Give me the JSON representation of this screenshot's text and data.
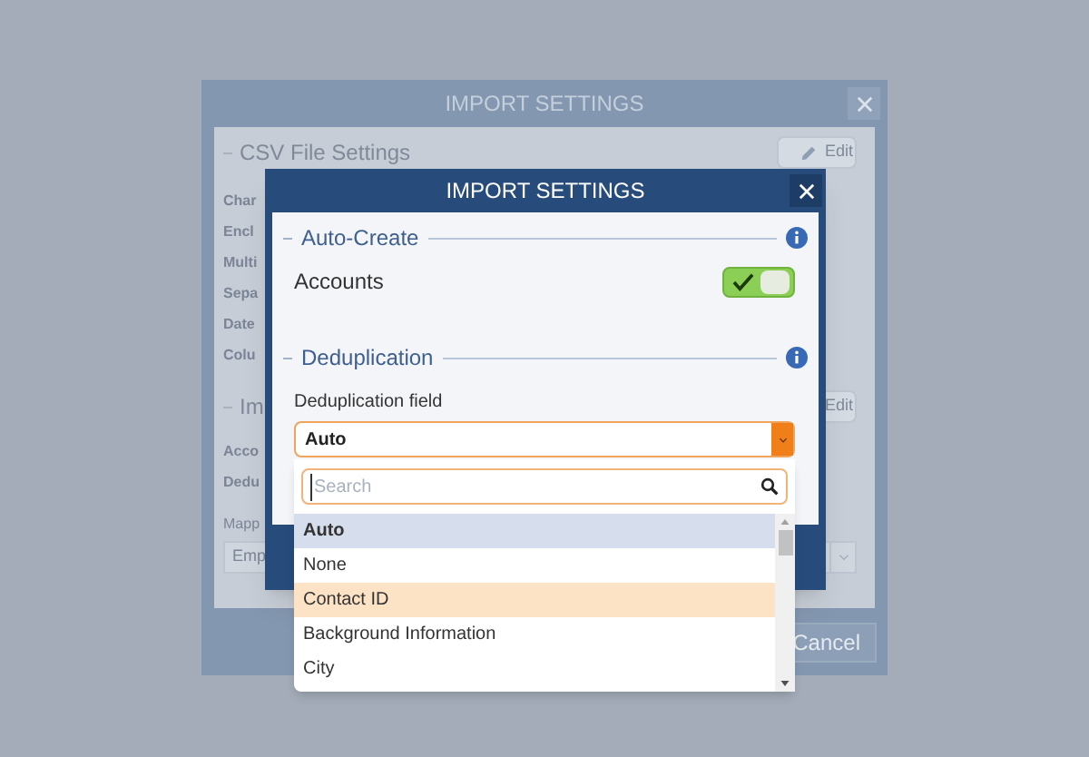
{
  "back_dialog": {
    "title": "IMPORT SETTINGS",
    "sections": [
      {
        "title": "CSV File Settings",
        "button": "Edit",
        "button_icon": true,
        "labels": [
          "Char",
          "Encl",
          "Multi",
          "Sepa",
          "Date",
          "Colu"
        ]
      },
      {
        "title": "Im",
        "button": "Edit",
        "labels": [
          "Acco",
          "Dedu"
        ]
      }
    ],
    "mapping_label": "Mapp",
    "mapping_value": "Emp",
    "cancel_button": "Cancel"
  },
  "dialog": {
    "title": "IMPORT SETTINGS",
    "auto_create": {
      "title": "Auto-Create",
      "toggles": [
        {
          "label": "Accounts",
          "on": true
        }
      ]
    },
    "deduplication": {
      "title": "Deduplication",
      "field_label": "Deduplication field",
      "value": "Auto",
      "dropdown": {
        "placeholder": "Search",
        "options": [
          {
            "label": "Auto",
            "selected": true,
            "highlighted": false
          },
          {
            "label": "None",
            "selected": false,
            "highlighted": false
          },
          {
            "label": "Contact ID",
            "selected": false,
            "highlighted": true
          },
          {
            "label": "Background Information",
            "selected": false,
            "highlighted": false
          },
          {
            "label": "City",
            "selected": false,
            "highlighted": false
          }
        ]
      }
    }
  }
}
